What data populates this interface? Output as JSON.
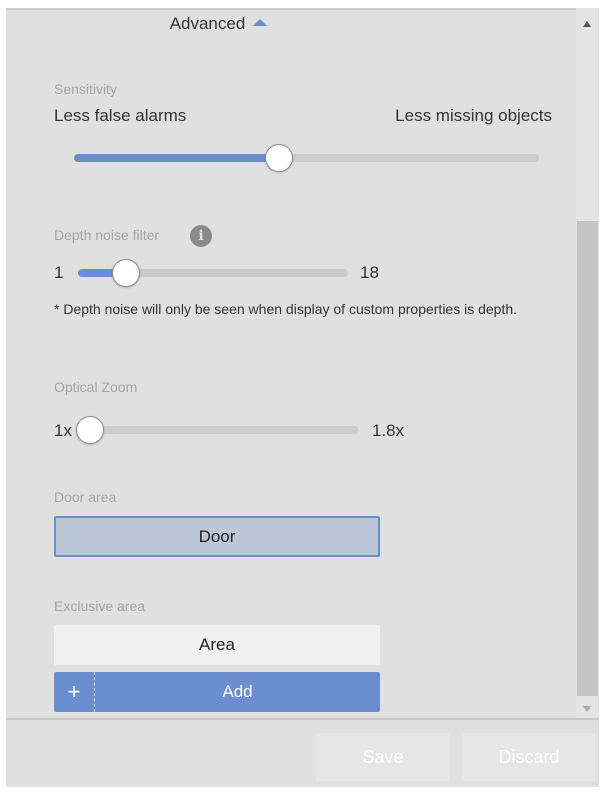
{
  "advanced": {
    "header": "Advanced",
    "caret_icon": "caret-up-icon"
  },
  "sensitivity": {
    "label": "Sensitivity",
    "min_label": "Less false alarms",
    "max_label": "Less missing objects",
    "value_fraction": 0.44
  },
  "depth_noise": {
    "label": "Depth noise filter",
    "info_icon": "i",
    "min": "1",
    "max": "18",
    "value": 4,
    "note": "* Depth noise will only be seen when display of custom properties is depth."
  },
  "optical_zoom": {
    "label": "Optical Zoom",
    "min": "1x",
    "max": "1.8x",
    "value_fraction": 0.0
  },
  "door_area": {
    "label": "Door area",
    "button": "Door"
  },
  "exclusive_area": {
    "label": "Exclusive area",
    "area_button": "Area",
    "add_plus": "+",
    "add_button": "Add"
  },
  "footer": {
    "save": "Save",
    "discard": "Discard"
  },
  "colors": {
    "accent": "#6a8ecf",
    "background": "#e0e0e0"
  }
}
